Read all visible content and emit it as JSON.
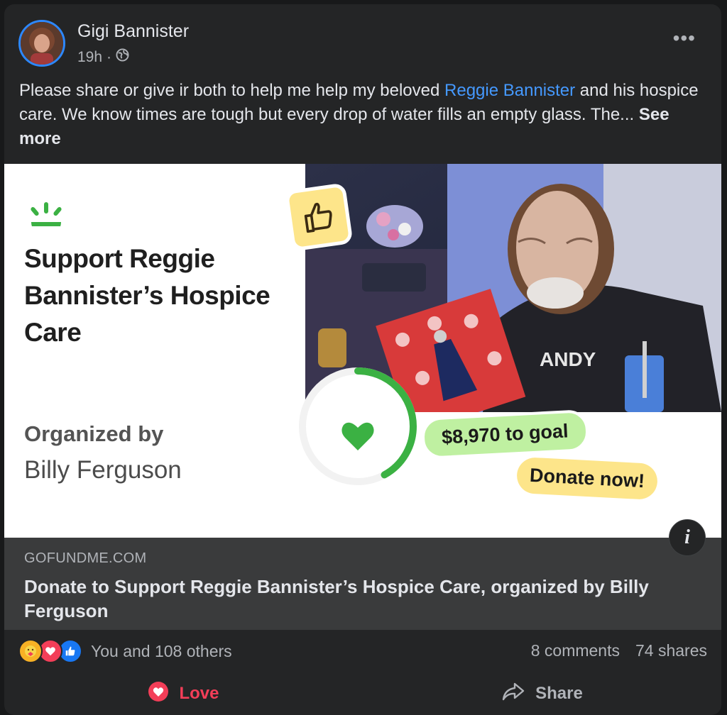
{
  "post": {
    "author": "Gigi Bannister",
    "timestamp": "19h",
    "separator": "·",
    "audience_icon": "globe-icon",
    "more_icon": "•••",
    "text_before": "Please share or give ir both to help me help my beloved ",
    "mention": "Reggie Bannister",
    "text_after": " and his hospice care. We know times are tough but every drop of water fills an empty glass. The... ",
    "see_more": "See more"
  },
  "card": {
    "title": "Support Reggie Bannister’s Hospice Care",
    "organized_label": "Organized by",
    "organizer": "Billy Ferguson",
    "to_goal": "$8,970 to goal",
    "donate": "Donate now!",
    "info_icon": "i",
    "progress_fraction": 0.42,
    "domain": "GOFUNDME.COM",
    "link_title": "Donate to Support Reggie Bannister’s Hospice Care, organized by Billy Ferguson"
  },
  "engagement": {
    "reactions": [
      "care-icon",
      "love-icon",
      "like-icon"
    ],
    "summary": "You and 108 others",
    "comments": "8 comments",
    "shares": "74 shares"
  },
  "actions": {
    "love": "Love",
    "share": "Share"
  },
  "colors": {
    "mention": "#4599ff",
    "love": "#f33e58",
    "gofundme_green": "#3bb143",
    "goal_badge": "#bff0a1",
    "donate_badge": "#fde58a"
  }
}
